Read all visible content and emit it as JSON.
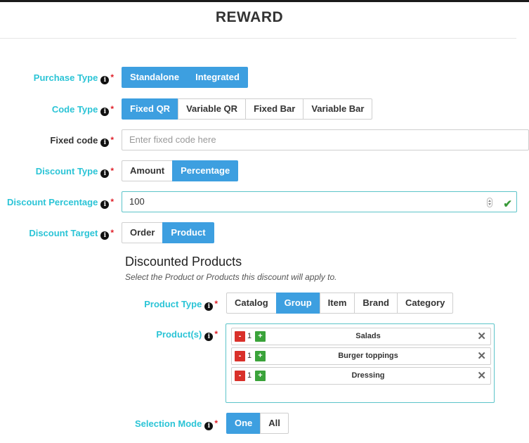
{
  "title": "REWARD",
  "fields": {
    "purchase_type": {
      "label": "Purchase Type",
      "options": [
        "Standalone",
        "Integrated"
      ],
      "selected": "Standalone"
    },
    "code_type": {
      "label": "Code Type",
      "options": [
        "Fixed QR",
        "Variable QR",
        "Fixed Bar",
        "Variable Bar"
      ],
      "selected": "Fixed QR"
    },
    "fixed_code": {
      "label": "Fixed code",
      "placeholder": "Enter fixed code here",
      "value": ""
    },
    "discount_type": {
      "label": "Discount Type",
      "options": [
        "Amount",
        "Percentage"
      ],
      "selected": "Percentage"
    },
    "discount_percentage": {
      "label": "Discount Percentage",
      "value": "100"
    },
    "discount_target": {
      "label": "Discount Target",
      "options": [
        "Order",
        "Product"
      ],
      "selected": "Product"
    }
  },
  "discounted_products": {
    "title": "Discounted Products",
    "subtitle": "Select the Product or Products this discount will apply to.",
    "product_type": {
      "label": "Product Type",
      "options": [
        "Catalog",
        "Group",
        "Item",
        "Brand",
        "Category"
      ],
      "selected": "Group"
    },
    "products": {
      "label": "Product(s)",
      "items": [
        {
          "qty": "1",
          "name": "Salads"
        },
        {
          "qty": "1",
          "name": "Burger toppings"
        },
        {
          "qty": "1",
          "name": "Dressing"
        }
      ]
    },
    "selection_mode": {
      "label": "Selection Mode",
      "options": [
        "One",
        "All"
      ],
      "selected": "One"
    }
  },
  "icons": {
    "info": "info-circle-icon",
    "required": "asterisk",
    "valid": "check-icon",
    "remove": "close-icon",
    "decrement": "minus-icon",
    "increment": "plus-icon"
  },
  "colors": {
    "label_accent": "#2bc4d6",
    "active_button": "#3d9fe0",
    "required_mark": "#e0202a",
    "minus_button": "#d9302a",
    "plus_button": "#3aa33a",
    "valid_check": "#3a9a3a"
  }
}
